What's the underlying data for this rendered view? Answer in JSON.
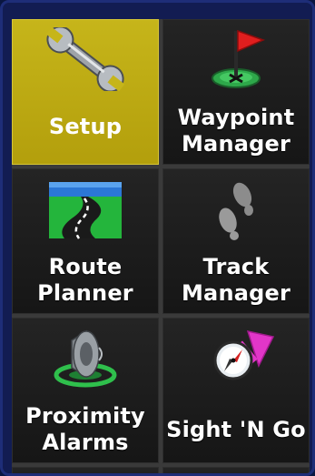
{
  "menu": {
    "items": [
      {
        "label": "Setup",
        "icon": "wrench-icon",
        "selected": true
      },
      {
        "label": "Waypoint\nManager",
        "icon": "flag-icon",
        "selected": false
      },
      {
        "label": "Route\nPlanner",
        "icon": "road-icon",
        "selected": false
      },
      {
        "label": "Track\nManager",
        "icon": "footprints-icon",
        "selected": false
      },
      {
        "label": "Proximity\nAlarms",
        "icon": "speaker-icon",
        "selected": false
      },
      {
        "label": "Sight 'N Go",
        "icon": "compass-icon",
        "selected": false
      }
    ]
  },
  "colors": {
    "background": "#121c52",
    "selected_tile": "#c6b51a",
    "tile": "#1b1b1b"
  }
}
